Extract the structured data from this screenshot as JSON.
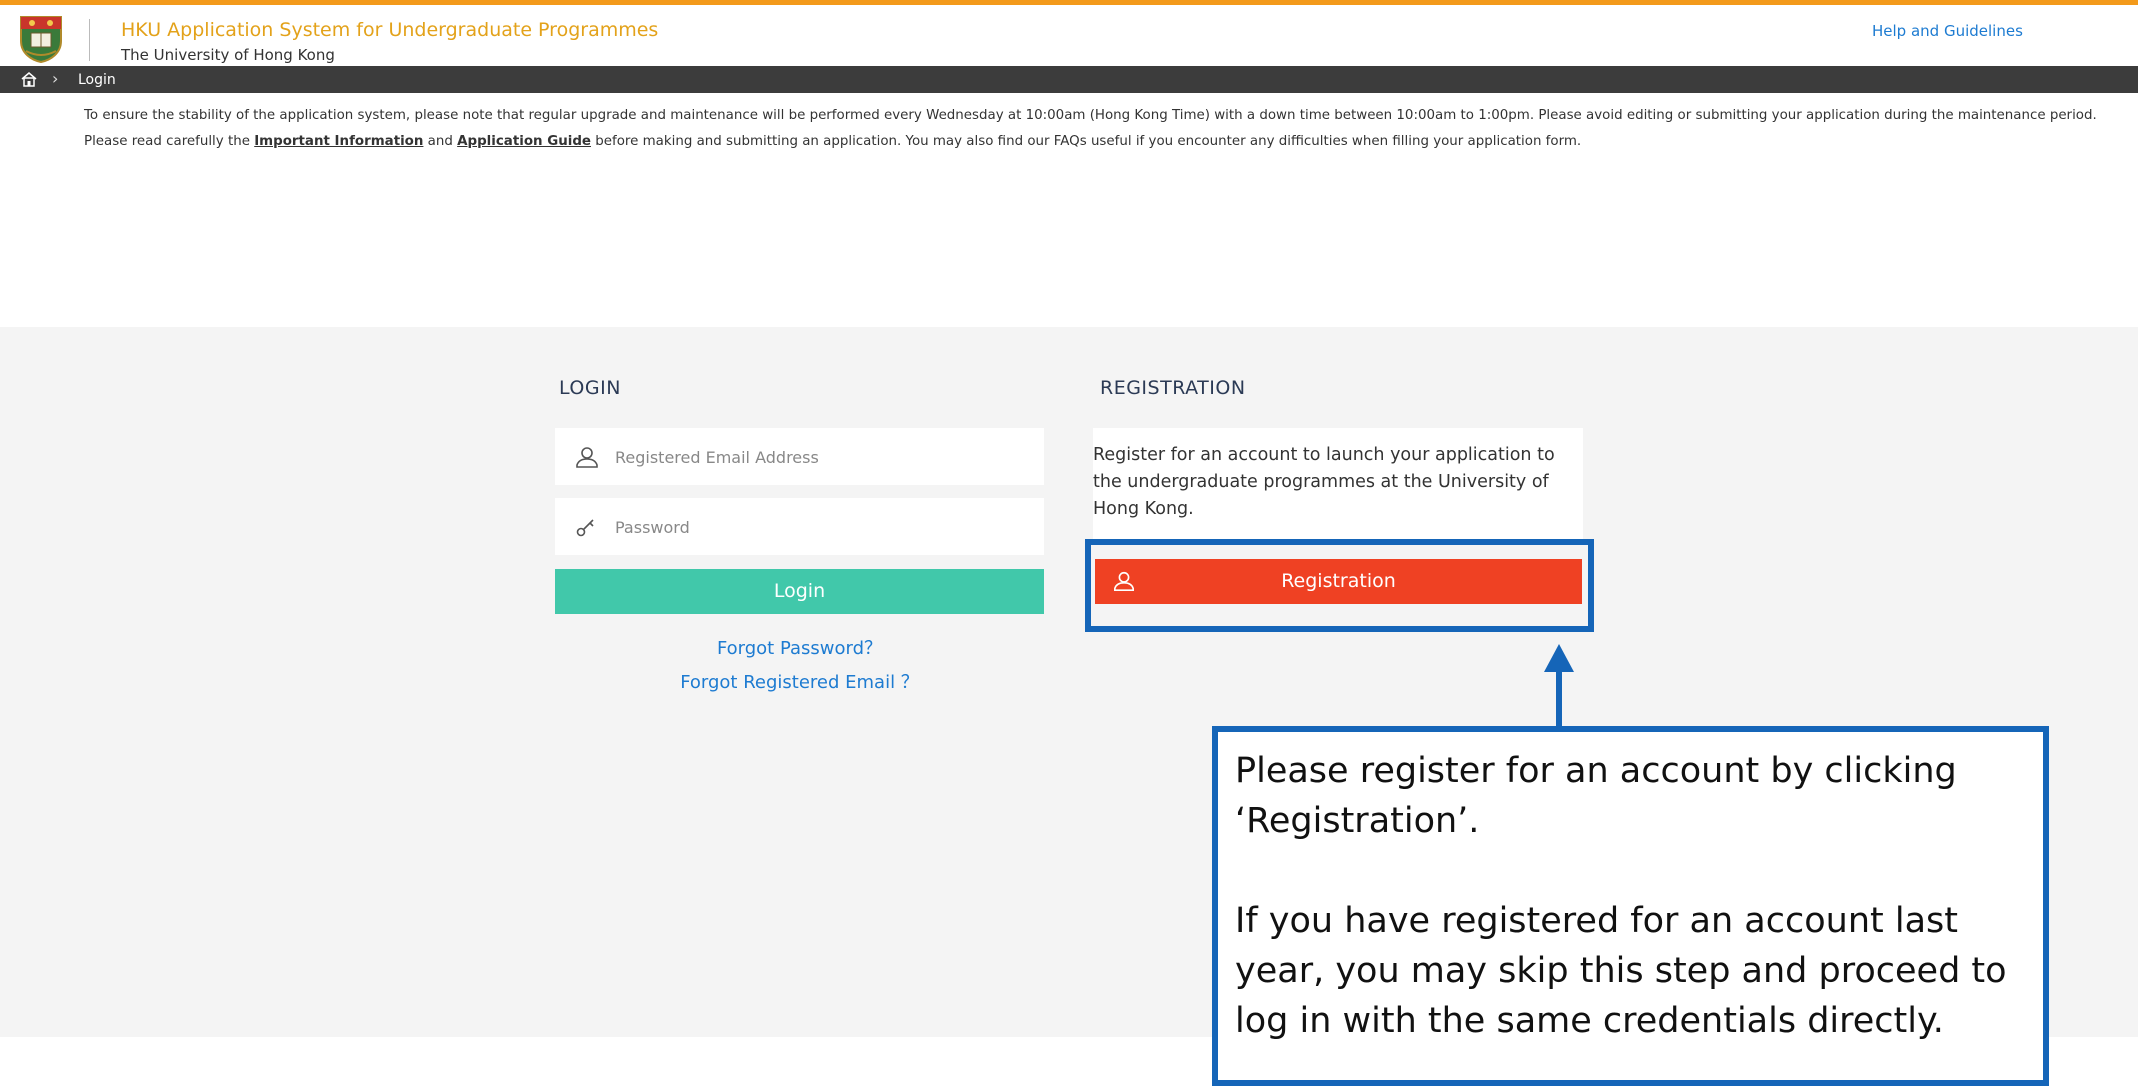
{
  "header": {
    "app_title": "HKU Application System for Undergraduate Programmes",
    "university": "The University of Hong Kong",
    "help_link": "Help and Guidelines"
  },
  "breadcrumb": {
    "current": "Login"
  },
  "notice": {
    "line1": "To ensure the stability of the application system, please note that regular upgrade and maintenance will be performed every Wednesday at 10:00am (Hong Kong Time) with a down time between 10:00am to 1:00pm. Please avoid editing or submitting your application during the maintenance period.",
    "line2_prefix": "Please read carefully the ",
    "important_info_link": "Important Information",
    "line2_and": " and ",
    "application_guide_link": "Application Guide",
    "line2_suffix": " before making and submitting an application. You may also find our FAQs useful if you encounter any difficulties when filling your application form."
  },
  "login": {
    "heading": "LOGIN",
    "email_placeholder": "Registered Email Address",
    "password_placeholder": "Password",
    "button": "Login",
    "forgot_password": "Forgot Password？",
    "forgot_email": "Forgot Registered Email ？"
  },
  "registration": {
    "heading": "REGISTRATION",
    "description": "Register for an account to launch your application to the undergraduate programmes at the University of Hong Kong.",
    "button": "Registration"
  },
  "callout": {
    "line1": "Please register for an account by clicking ‘Registration’.",
    "line2": "If you have registered for an account last year, you may skip this step and proceed to log in with the same credentials directly."
  },
  "colors": {
    "top_accent": "#f39a1b",
    "login_button": "#41c8aa",
    "registration_button": "#ef4123",
    "annotation": "#1565b8"
  }
}
